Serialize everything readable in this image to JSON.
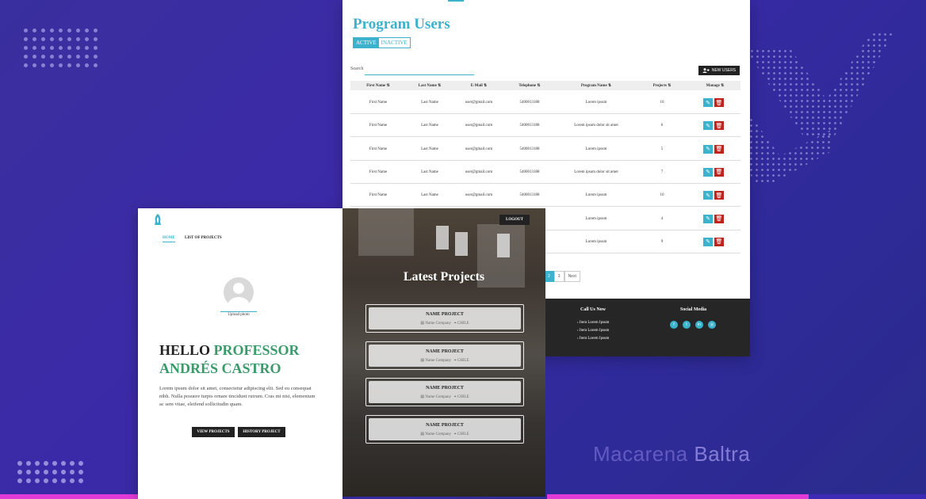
{
  "admin": {
    "title": "Program Users",
    "tabs": [
      {
        "label": "ACTIVE"
      },
      {
        "label": "INACTIVE"
      }
    ],
    "search_label": "Search",
    "new_user_label": "NEW USERS",
    "columns": [
      "First Name",
      "Last Name",
      "E-Mail",
      "Telephone",
      "Program Name",
      "Projects",
      "Manage"
    ],
    "rows": [
      {
        "first": "First Name",
        "last": "Last Name",
        "email": "user@gmail.com",
        "phone": "5400013188",
        "program": "Lorem ipsum",
        "projects": "10"
      },
      {
        "first": "First Name",
        "last": "Last Name",
        "email": "user@gmail.com",
        "phone": "5400013188",
        "program": "Lorem ipsum dolor sit amet",
        "projects": "6"
      },
      {
        "first": "First Name",
        "last": "Last Name",
        "email": "user@gmail.com",
        "phone": "5400013188",
        "program": "Lorem ipsum",
        "projects": "5"
      },
      {
        "first": "First Name",
        "last": "Last Name",
        "email": "user@gmail.com",
        "phone": "5400013188",
        "program": "Lorem ipsum dolor sit amet",
        "projects": "7"
      },
      {
        "first": "First Name",
        "last": "Last Name",
        "email": "user@gmail.com",
        "phone": "5400013188",
        "program": "Lorem ipsum",
        "projects": "10"
      },
      {
        "program": "Lorem ipsum",
        "projects": "4"
      },
      {
        "program": "Lorem ipsum",
        "projects": "9"
      }
    ],
    "pagination": [
      {
        "label": "2"
      },
      {
        "label": "3"
      },
      {
        "label": "Next"
      }
    ],
    "footer": {
      "call_title": "Call Us Now",
      "call_items": [
        "Item Lorem Ipsum",
        "Item Lorem Ipsum",
        "Item Lorem Ipsum"
      ],
      "social_title": "Social Media",
      "social_icons": [
        "facebook-icon",
        "twitter-icon",
        "linkedin-icon",
        "instagram-icon"
      ]
    }
  },
  "professor": {
    "nav_home": "HOME",
    "nav_projects": "LIST OF PROJECTS",
    "upload_label": "Upload photo",
    "hello_word": "HELLO",
    "hello_role": "PROFESSOR",
    "hello_name": "ANDRÉS CASTRO",
    "description": "Lorem ipsum dolor sit amet, consectetur adipiscing elit. Sed eu consequat nibh. Nulla posuere turpis ornare tincidunt rutrum. Cras mi nisi, elementum ac sem vitae, eleifend sollicitudin quam.",
    "view_projects": "VIEW PROJECTS",
    "history_project": "HISTORY PROJECT"
  },
  "projects": {
    "logout": "LOGOUT",
    "title": "Latest Projects",
    "cards": [
      {
        "name": "NAME PROJECT",
        "company": "Name Company",
        "country": "CHILE"
      },
      {
        "name": "NAME PROJECT",
        "company": "Name Company",
        "country": "CHILE"
      },
      {
        "name": "NAME PROJECT",
        "company": "Name Company",
        "country": "CHILE"
      },
      {
        "name": "NAME PROJECT",
        "company": "Name Company",
        "country": "CHILE"
      }
    ]
  },
  "signature": {
    "first": "Macarena",
    "last": "Baltra"
  },
  "colors": {
    "accent": "#3cb2cc",
    "green": "#3a9a6a",
    "delete": "#c0231c",
    "dark": "#222222",
    "magenta": "#e23ad6"
  }
}
